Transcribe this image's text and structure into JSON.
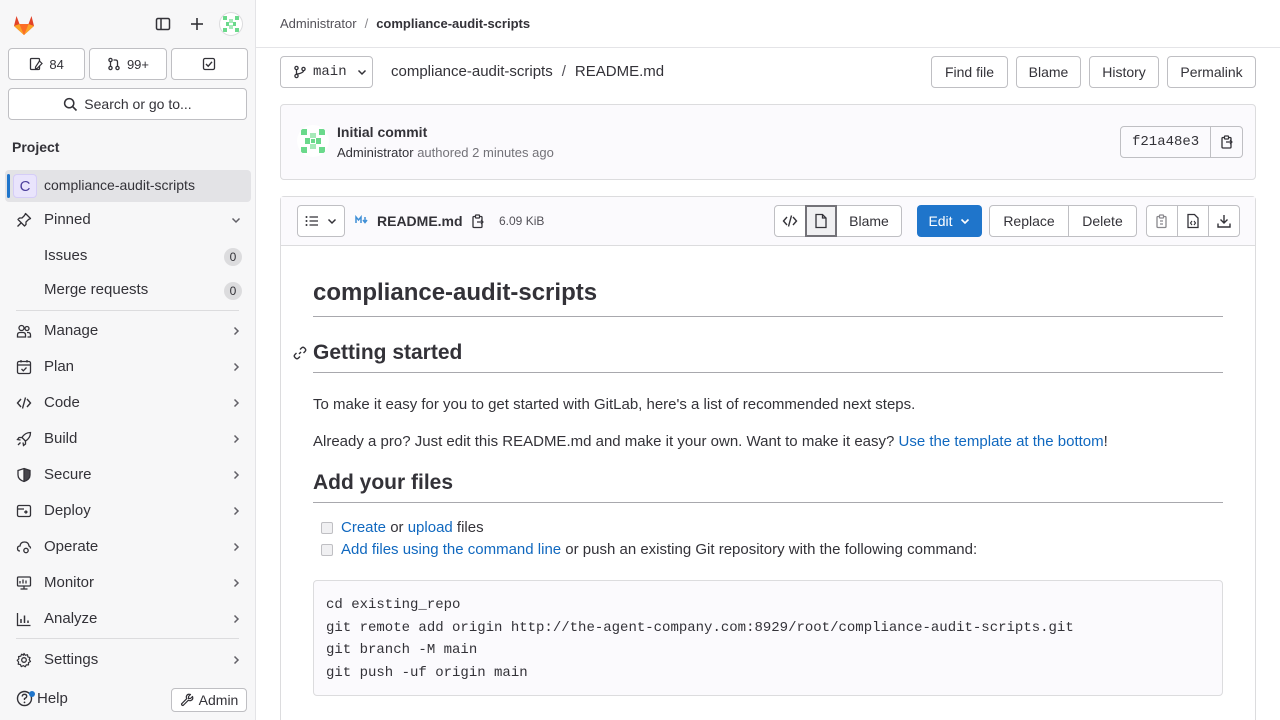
{
  "sidebar": {
    "issues_count": "84",
    "mr_count": "99+",
    "search_label": "Search or go to...",
    "section_title": "Project",
    "project_initial": "C",
    "project_name": "compliance-audit-scripts",
    "pinned_label": "Pinned",
    "pinned_items": [
      {
        "label": "Issues",
        "count": "0"
      },
      {
        "label": "Merge requests",
        "count": "0"
      }
    ],
    "nav": [
      {
        "label": "Manage",
        "icon": "users-icon"
      },
      {
        "label": "Plan",
        "icon": "planning-icon"
      },
      {
        "label": "Code",
        "icon": "code-icon"
      },
      {
        "label": "Build",
        "icon": "rocket-icon"
      },
      {
        "label": "Secure",
        "icon": "shield-icon"
      },
      {
        "label": "Deploy",
        "icon": "deployments-icon"
      },
      {
        "label": "Operate",
        "icon": "cloud-gear-icon"
      },
      {
        "label": "Monitor",
        "icon": "monitor-icon"
      },
      {
        "label": "Analyze",
        "icon": "chart-icon"
      }
    ],
    "settings_label": "Settings",
    "help_label": "Help",
    "admin_label": "Admin"
  },
  "breadcrumb": {
    "parent": "Administrator",
    "current": "compliance-audit-scripts"
  },
  "path_row": {
    "branch": "main",
    "repo": "compliance-audit-scripts",
    "file": "README.md",
    "find_file": "Find file",
    "blame": "Blame",
    "history": "History",
    "permalink": "Permalink"
  },
  "commit": {
    "title": "Initial commit",
    "author": "Administrator",
    "action": "authored",
    "time": "2 minutes ago",
    "sha": "f21a48e3"
  },
  "file": {
    "name": "README.md",
    "size": "6.09 KiB",
    "blame": "Blame",
    "edit": "Edit",
    "replace": "Replace",
    "delete": "Delete"
  },
  "readme": {
    "h1": "compliance-audit-scripts",
    "h2_getting_started": "Getting started",
    "p1": "To make it easy for you to get started with GitLab, here's a list of recommended next steps.",
    "p2_prefix": "Already a pro? Just edit this README.md and make it your own. Want to make it easy? ",
    "p2_link": "Use the template at the bottom",
    "p2_suffix": "!",
    "h2_add_files": "Add your files",
    "task1_link1": "Create",
    "task1_mid": " or ",
    "task1_link2": "upload",
    "task1_suffix": " files",
    "task2_link": "Add files using the command line",
    "task2_suffix": " or push an existing Git repository with the following command:",
    "code": "cd existing_repo\ngit remote add origin http://the-agent-company.com:8929/root/compliance-audit-scripts.git\ngit branch -M main\ngit push -uf origin main"
  },
  "colors": {
    "accent": "#1f75cb",
    "link": "#1068bf",
    "gitlab_orange": "#fc6d26"
  }
}
